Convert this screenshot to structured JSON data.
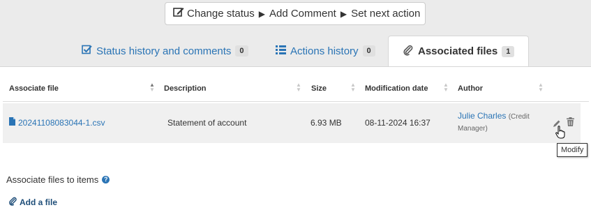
{
  "action_bar": {
    "change_status": "Change status",
    "add_comment": "Add Comment",
    "set_next_action": "Set next action"
  },
  "tabs": [
    {
      "label": "Status history and comments",
      "count": "0",
      "icon": "checkbox-icon"
    },
    {
      "label": "Actions history",
      "count": "0",
      "icon": "list-icon"
    },
    {
      "label": "Associated files",
      "count": "1",
      "icon": "paperclip-icon",
      "active": true
    }
  ],
  "table": {
    "headers": [
      "Associate file",
      "Description",
      "Size",
      "Modification date",
      "Author"
    ],
    "rows": [
      {
        "file": "20241108083044-1.csv",
        "description": "Statement of account",
        "size": "6.93 MB",
        "date": "08-11-2024 16:37",
        "author_name": "Julie Charles",
        "author_role_1": "(Credit",
        "author_role_2": "Manager)"
      }
    ]
  },
  "tooltip": "Modify",
  "section_title": "Associate files to items",
  "add_file": "Add a file",
  "colors": {
    "link": "#2a74b5",
    "band": "#ebebeb",
    "row": "#f0f0f0"
  }
}
